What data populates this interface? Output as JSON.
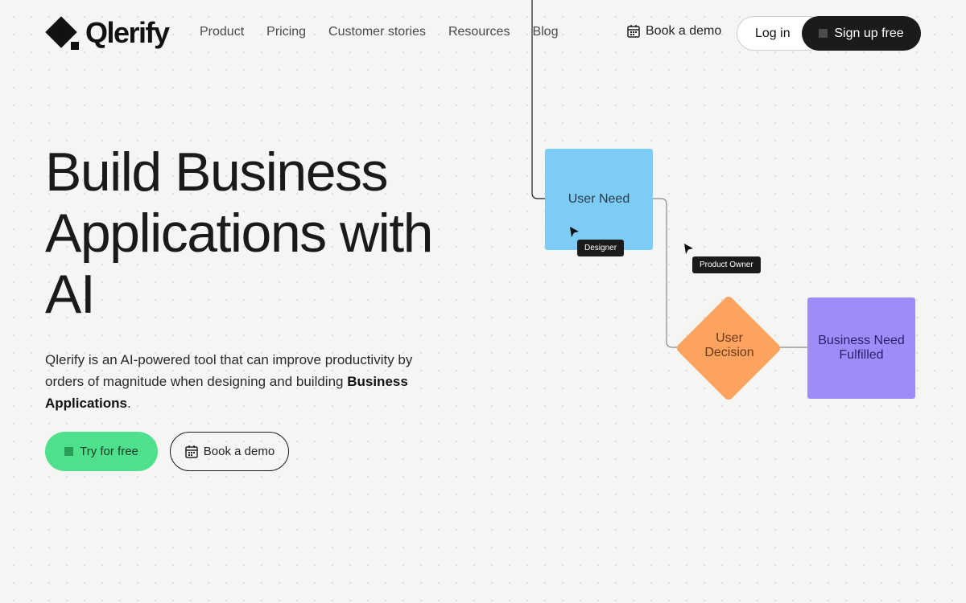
{
  "header": {
    "logo_text": "Qlerify",
    "nav": [
      "Product",
      "Pricing",
      "Customer stories",
      "Resources",
      "Blog"
    ],
    "book_demo": "Book a demo",
    "login": "Log in",
    "signup": "Sign up free"
  },
  "hero": {
    "title_line1": "Build Business",
    "title_line2": "Applications with",
    "title_line3": "AI",
    "desc_part1": "Qlerify is an AI-powered tool that can improve productivity by orders of magnitude when designing and building",
    "desc_bold": "Business Applications",
    "desc_end": ".",
    "try_button": "Try for free",
    "demo_button": "Book a demo"
  },
  "diagram": {
    "node_user_need": "User Need",
    "node_user_decision_line1": "User",
    "node_user_decision_line2": "Decision",
    "node_business_line1": "Business Need",
    "node_business_line2": "Fulfilled",
    "tag_designer": "Designer",
    "tag_product_owner": "Product Owner"
  },
  "colors": {
    "user_need": "#7dccf5",
    "decision": "#fca35f",
    "business": "#a08cf8",
    "try_button": "#4ee08c",
    "signup_button": "#1b1b1b"
  }
}
